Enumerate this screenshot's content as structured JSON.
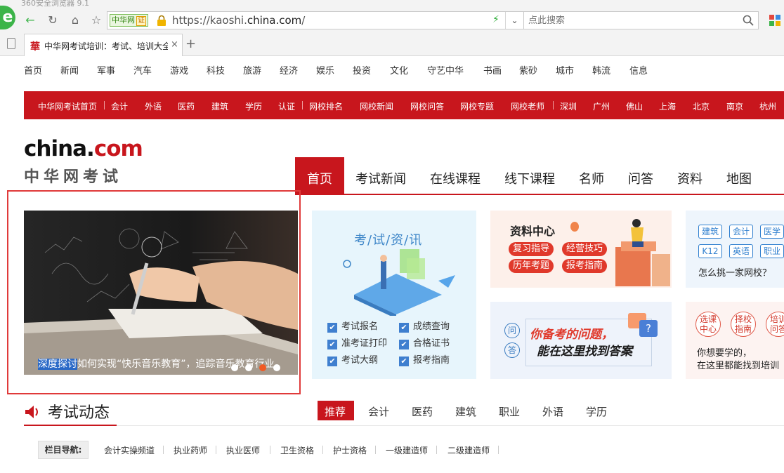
{
  "browser": {
    "window_title": "360安全浏览器 9.1",
    "url_prefix": "https://",
    "url_sub": "kaoshi.",
    "url_domain": "china.com",
    "url_suffix": "/",
    "site_badge": "中华网",
    "site_badge_cert": "证",
    "search_placeholder": "点此搜索",
    "tab_favicon": "華",
    "tab_title": "中华网考试培训：考试、培训大全",
    "tab_close": "×",
    "new_tab": "+"
  },
  "top_nav": [
    "首页",
    "新闻",
    "军事",
    "汽车",
    "游戏",
    "科技",
    "旅游",
    "经济",
    "娱乐",
    "投资",
    "文化",
    "守艺中华",
    "书画",
    "紫砂",
    "城市",
    "韩流",
    "信息"
  ],
  "red_bar": [
    "中华网考试首页",
    "会计",
    "外语",
    "医药",
    "建筑",
    "学历",
    "认证",
    "网校排名",
    "网校新闻",
    "网校问答",
    "网校专题",
    "网校老师",
    "深圳",
    "广州",
    "佛山",
    "上海",
    "北京",
    "南京",
    "杭州"
  ],
  "logo": {
    "part1": "china.",
    "part2": "com",
    "sub": "中华网考试"
  },
  "main_nav": [
    "首页",
    "考试新闻",
    "在线课程",
    "线下课程",
    "名师",
    "问答",
    "资料",
    "地图"
  ],
  "slide": {
    "caption_selected": "深度探讨",
    "caption_rest": "如何实现“快乐音乐教育”，追踪音乐教育行业"
  },
  "card_exam": {
    "title": "考/试/资/讯",
    "items": [
      "考试报名",
      "成绩查询",
      "准考证打印",
      "合格证书",
      "考试大纲",
      "报考指南"
    ]
  },
  "card_materials": {
    "title": "资料中心",
    "pills": [
      "复习指导",
      "经营技巧",
      "历年考题",
      "报考指南"
    ]
  },
  "card_school": {
    "tags": [
      "建筑",
      "会计",
      "医学",
      "K12",
      "英语",
      "职业"
    ],
    "caption": "怎么挑一家网校？"
  },
  "card_qa": {
    "q1": "问",
    "q2": "答",
    "line1": "你备考的问题，",
    "line2": "能在这里找到答案",
    "badge": "?"
  },
  "card_course": {
    "circles": [
      "选课中心",
      "择校指南",
      "培训问答"
    ],
    "line1": "你想要学的，",
    "line2": "在这里都能找到培训"
  },
  "exam_dynamics": {
    "title": "考试动态",
    "tabs": [
      "推荐",
      "会计",
      "医药",
      "建筑",
      "职业",
      "外语",
      "学历"
    ]
  },
  "column_nav": {
    "label": "栏目导航:",
    "items": [
      "会计实操频道",
      "执业药师",
      "执业医师",
      "卫生资格",
      "护士资格",
      "一级建造师",
      "二级建造师"
    ]
  },
  "colors": {
    "brand_red": "#c8161d",
    "link_blue": "#2f7fcf",
    "accent_green": "#3cb449"
  }
}
